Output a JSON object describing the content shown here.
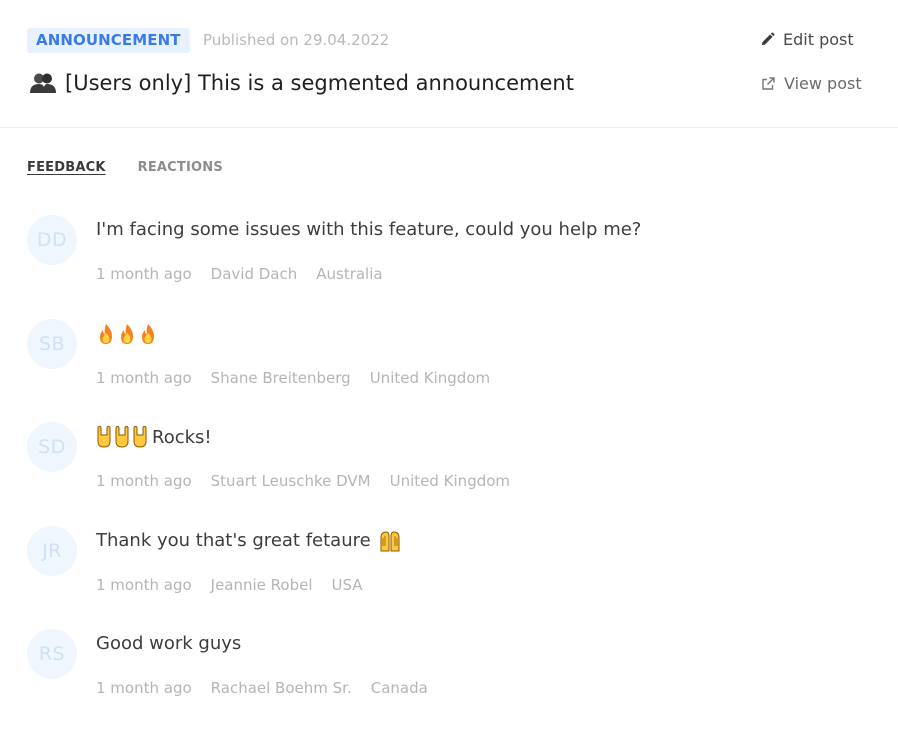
{
  "header": {
    "badge": "ANNOUNCEMENT",
    "published": "Published on 29.04.2022",
    "title": "[Users only] This is a segmented announcement",
    "title_icon": "users-segment-icon",
    "edit_label": "Edit post",
    "view_label": "View post"
  },
  "tabs": [
    {
      "label": "FEEDBACK",
      "active": true
    },
    {
      "label": "REACTIONS",
      "active": false
    }
  ],
  "feedback": [
    {
      "initials": "DD",
      "message": "I'm facing some issues with this feature, could you help me?",
      "emoji": "",
      "time": "1 month ago",
      "author": "David Dach",
      "country": "Australia"
    },
    {
      "initials": "SB",
      "message": "",
      "emoji": "fire-x3",
      "time": "1 month ago",
      "author": "Shane Breitenberg",
      "country": "United Kingdom"
    },
    {
      "initials": "SD",
      "message": "Rocks!",
      "emoji": "rock-hand-x3",
      "time": "1 month ago",
      "author": "Stuart Leuschke DVM",
      "country": "United Kingdom"
    },
    {
      "initials": "JR",
      "message": "Thank you that's great fetaure",
      "emoji": "raising-hands",
      "time": "1 month ago",
      "author": "Jeannie Robel",
      "country": "USA"
    },
    {
      "initials": "RS",
      "message": "Good work guys",
      "emoji": "",
      "time": "1 month ago",
      "author": "Rachael Boehm Sr.",
      "country": "Canada"
    }
  ],
  "colors": {
    "badge_bg": "#e8f1fe",
    "badge_text": "#3b7be6",
    "avatar_bg": "#f0f6fe",
    "avatar_text": "#cfe0f7",
    "meta_text": "#b5b5b5"
  }
}
